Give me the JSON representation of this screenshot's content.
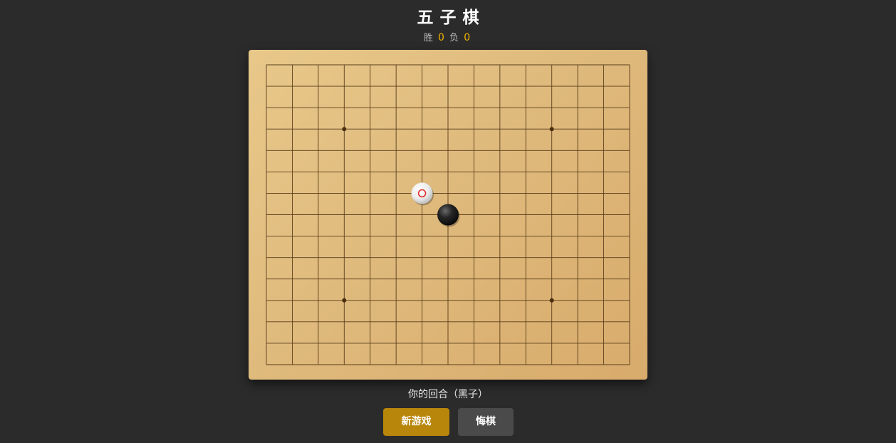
{
  "header": {
    "title": "五子棋",
    "win_label": "胜",
    "win_count": "0",
    "loss_label": "负",
    "loss_count": "0"
  },
  "board": {
    "lines": 15,
    "star_points": [
      [
        3,
        3
      ],
      [
        11,
        3
      ],
      [
        3,
        11
      ],
      [
        11,
        11
      ]
    ],
    "stones": [
      {
        "col": 6,
        "row": 6,
        "color": "white",
        "marker": "last-move"
      },
      {
        "col": 7,
        "row": 7,
        "color": "black"
      }
    ],
    "colors": {
      "grid": "#5a3d1a",
      "star": "#4a2e10",
      "last_move_marker": "#e03030"
    }
  },
  "status": {
    "text": "你的回合（黑子）"
  },
  "buttons": {
    "new_game": "新游戏",
    "undo": "悔棋"
  },
  "colors": {
    "background": "#2b2b2b",
    "accent": "#f0b400",
    "new_game_button": "#b8860b",
    "undo_button": "#4a4a4a"
  }
}
